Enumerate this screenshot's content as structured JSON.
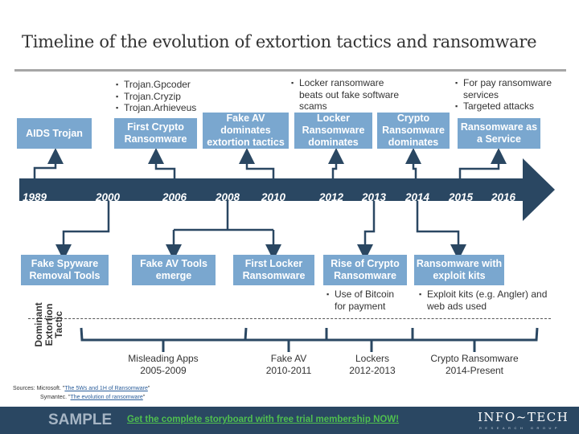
{
  "title": "Timeline of the evolution of extortion tactics and ransomware",
  "colors": {
    "box": "#7aa7cf",
    "arrow": "#2a4762",
    "connector": "#2a4762",
    "banner": "#2a4762",
    "cta": "#4fbf4f"
  },
  "timeline": {
    "years": [
      "1989",
      "2000",
      "2006",
      "2008",
      "2010",
      "2012",
      "2013",
      "2014",
      "2015",
      "2016"
    ]
  },
  "top_events": [
    {
      "label": "AIDS Trojan",
      "year": "1989"
    },
    {
      "label": "First Crypto Ransomware",
      "year": "2006",
      "notes": [
        "Trojan.Gpcoder",
        "Trojan.Cryzip",
        "Trojan.Arhieveus"
      ]
    },
    {
      "label": "Fake AV dominates extortion tactics",
      "year": "2010"
    },
    {
      "label": "Locker Ransomware dominates",
      "year": "2012",
      "notes": [
        "Locker ransomware beats out fake software scams"
      ]
    },
    {
      "label": "Crypto Ransomware dominates",
      "year": "2014"
    },
    {
      "label": "Ransomware as a Service",
      "year": "2015",
      "notes": [
        "For pay ransomware services",
        "Targeted attacks"
      ]
    }
  ],
  "bottom_events": [
    {
      "label": "Fake Spyware Removal Tools",
      "year": "2000"
    },
    {
      "label": "Fake AV Tools emerge",
      "year": "2008"
    },
    {
      "label": "First Locker Ransomware",
      "year": "2008"
    },
    {
      "label": "Rise of Crypto Ransomware",
      "year": "2013",
      "notes": [
        "Use of Bitcoin for payment"
      ]
    },
    {
      "label": "Ransomware with exploit kits",
      "year": "2014",
      "notes": [
        "Exploit kits (e.g. Angler) and web ads used"
      ]
    }
  ],
  "dominant": {
    "label": "Dominant Extortion Tactic",
    "eras": [
      {
        "name": "Misleading Apps",
        "range": "2005-2009"
      },
      {
        "name": "Fake AV",
        "range": "2010-2011"
      },
      {
        "name": "Lockers",
        "range": "2012-2013"
      },
      {
        "name": "Crypto Ransomware",
        "range": "2014-Present"
      }
    ]
  },
  "sources": {
    "label": "Sources:",
    "items": [
      {
        "org": "Microsoft.",
        "link": "The 5Ws and 1H of Ransomware"
      },
      {
        "org": "Symantec.",
        "link": "The evolution of ransomware"
      }
    ]
  },
  "banner": {
    "sample": "SAMPLE",
    "cta": "Get the complete storyboard with free trial membership NOW!",
    "logo": "INFO~TECH",
    "logo_sub": "RESEARCH GROUP"
  }
}
